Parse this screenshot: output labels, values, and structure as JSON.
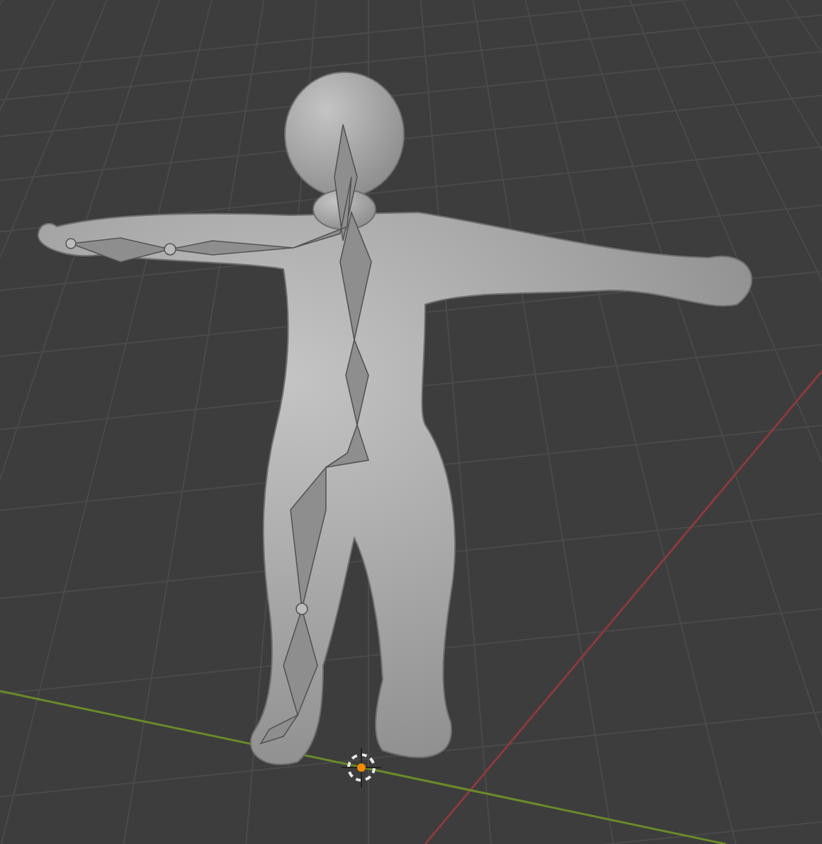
{
  "viewport": {
    "objects": [
      {
        "kind": "grid"
      },
      {
        "kind": "mesh"
      },
      {
        "kind": "armature"
      },
      {
        "kind": "cursor"
      }
    ]
  }
}
